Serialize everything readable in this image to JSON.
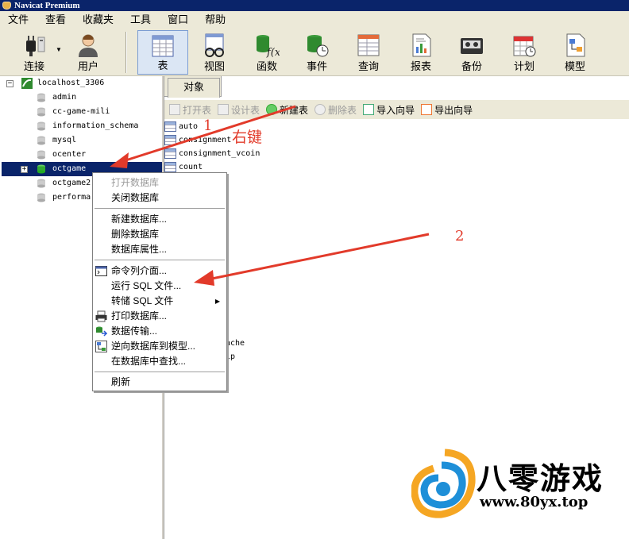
{
  "window": {
    "title": "Navicat Premium"
  },
  "menubar": [
    "文件",
    "查看",
    "收藏夹",
    "工具",
    "窗口",
    "帮助"
  ],
  "toolbar": {
    "buttons": [
      {
        "label": "连接",
        "icon": "connection-plug-icon"
      },
      {
        "label": "用户",
        "icon": "user-icon"
      },
      {
        "label": "表",
        "icon": "table-icon",
        "active": true
      },
      {
        "label": "视图",
        "icon": "view-glasses-icon"
      },
      {
        "label": "函数",
        "icon": "function-icon"
      },
      {
        "label": "事件",
        "icon": "event-clock-icon"
      },
      {
        "label": "查询",
        "icon": "query-icon"
      },
      {
        "label": "报表",
        "icon": "report-icon"
      },
      {
        "label": "备份",
        "icon": "backup-tape-icon"
      },
      {
        "label": "计划",
        "icon": "calendar-schedule-icon"
      },
      {
        "label": "模型",
        "icon": "model-icon"
      }
    ]
  },
  "tree": {
    "connection": "localhost_3306",
    "databases": [
      "admin",
      "cc-game-mili",
      "information_schema",
      "mysql",
      "ocenter",
      "octgame",
      "octgame2",
      "performa"
    ],
    "selected": "octgame"
  },
  "tabs": {
    "objects": "对象"
  },
  "object_toolbar": [
    {
      "label": "打开表",
      "disabled": true
    },
    {
      "label": "设计表",
      "disabled": true
    },
    {
      "label": "新建表",
      "disabled": false
    },
    {
      "label": "删除表",
      "disabled": true
    },
    {
      "label": "导入向导",
      "disabled": false
    },
    {
      "label": "导出向导",
      "disabled": false
    }
  ],
  "tables": [
    "auto",
    "consignment",
    "consignment_vcoin",
    "count"
  ],
  "tables_partial": [
    "ache",
    "ip"
  ],
  "context_menu": {
    "groups": [
      [
        {
          "label": "打开数据库",
          "disabled": true
        },
        {
          "label": "关闭数据库",
          "disabled": false
        }
      ],
      [
        {
          "label": "新建数据库...",
          "disabled": false
        },
        {
          "label": "删除数据库",
          "disabled": false
        },
        {
          "label": "数据库属性...",
          "disabled": false
        }
      ],
      [
        {
          "label": "命令列介面...",
          "icon": "console-icon"
        },
        {
          "label": "运行 SQL 文件..."
        },
        {
          "label": "转储 SQL 文件",
          "submenu": true
        },
        {
          "label": "打印数据库...",
          "icon": "printer-icon"
        },
        {
          "label": "数据传输...",
          "icon": "data-transfer-icon"
        },
        {
          "label": "逆向数据库到模型...",
          "icon": "reverse-model-icon"
        },
        {
          "label": "在数据库中查找..."
        }
      ],
      [
        {
          "label": "刷新"
        }
      ]
    ]
  },
  "annotations": {
    "step1": "1",
    "step1_hint": "右键",
    "step2": "2"
  },
  "watermark": {
    "title": "八零游戏",
    "url": "www.80yx.top"
  },
  "colors": {
    "selection": "#0a246a",
    "annotation": "#e23a2a",
    "toolbar_bg": "#ece9d8"
  }
}
